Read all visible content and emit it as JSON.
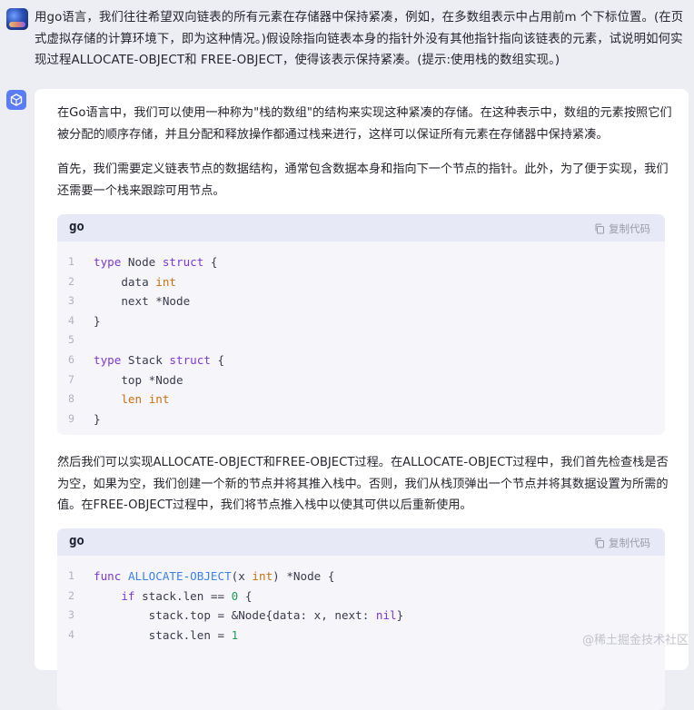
{
  "user": {
    "text": "用go语言，我们往往希望双向链表的所有元素在存储器中保持紧凑，例如，在多数组表示中占用前m 个下标位置。(在页式虚拟存储的计算环境下，即为这种情况。)假设除指向链表本身的指针外没有其他指针指向该链表的元素，试说明如何实现过程ALLOCATE-OBJECT和 FREE-OBJECT，使得该表示保持紧凑。(提示:使用栈的数组实现。)"
  },
  "answer": {
    "p1": "在Go语言中，我们可以使用一种称为\"栈的数组\"的结构来实现这种紧凑的存储。在这种表示中，数组的元素按照它们被分配的顺序存储，并且分配和释放操作都通过栈来进行，这样可以保证所有元素在存储器中保持紧凑。",
    "p2": "首先，我们需要定义链表节点的数据结构，通常包含数据本身和指向下一个节点的指针。此外，为了便于实现，我们还需要一个栈来跟踪可用节点。",
    "p3": "然后我们可以实现ALLOCATE-OBJECT和FREE-OBJECT过程。在ALLOCATE-OBJECT过程中，我们首先检查栈是否为空，如果为空，我们创建一个新的节点并将其推入栈中。否则，我们从栈顶弹出一个节点并将其数据设置为所需的值。在FREE-OBJECT过程中，我们将节点推入栈中以使其可供以后重新使用。"
  },
  "code1": {
    "lang": "go",
    "copy_label": "复制代码",
    "lines": [
      {
        "n": "1",
        "code": "type Node struct {"
      },
      {
        "n": "2",
        "code": "    data int"
      },
      {
        "n": "3",
        "code": "    next *Node"
      },
      {
        "n": "4",
        "code": "}"
      },
      {
        "n": "5",
        "code": ""
      },
      {
        "n": "6",
        "code": "type Stack struct {"
      },
      {
        "n": "7",
        "code": "    top *Node"
      },
      {
        "n": "8",
        "code": "    len int"
      },
      {
        "n": "9",
        "code": "}"
      }
    ]
  },
  "code2": {
    "lang": "go",
    "copy_label": "复制代码",
    "lines": [
      {
        "n": "1",
        "code": "func ALLOCATE-OBJECT(x int) *Node {"
      },
      {
        "n": "2",
        "code": "    if stack.len == 0 {"
      },
      {
        "n": "3",
        "code": "        stack.top = &Node{data: x, next: nil}"
      },
      {
        "n": "4",
        "code": "        stack.len = 1"
      }
    ]
  },
  "watermark": "@稀土掘金技术社区",
  "colors": {
    "background": "#edeef3",
    "card": "#ffffff",
    "code_bg": "#f5f5fa",
    "code_header": "#e7e9f7",
    "keyword": "#7b39d9",
    "type": "#c9710f",
    "function": "#3a82e8",
    "number": "#1f9d55",
    "bot_avatar": "#5b7cf7"
  }
}
